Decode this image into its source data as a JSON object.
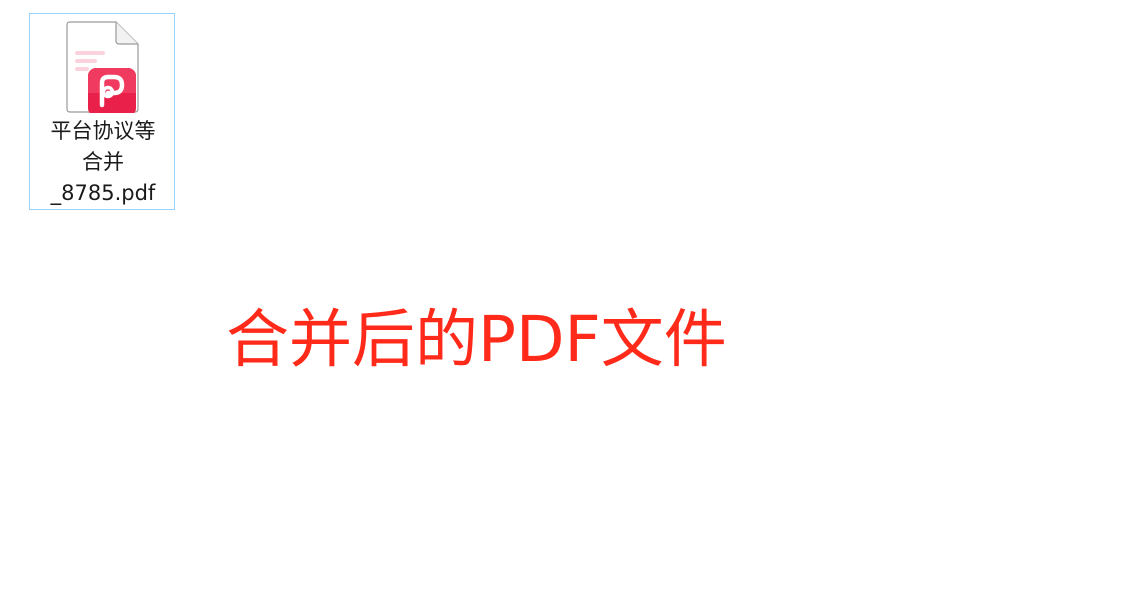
{
  "desktop": {
    "file": {
      "icon": "wps-pdf-file-icon",
      "name_lines": [
        "平台协议等",
        "合并",
        "_8785.pdf"
      ]
    },
    "caption": "合并后的PDF文件"
  },
  "colors": {
    "selection_border": "#99d1ff",
    "caption_text": "#ff2a1a",
    "pdf_badge": "#e8204a"
  }
}
